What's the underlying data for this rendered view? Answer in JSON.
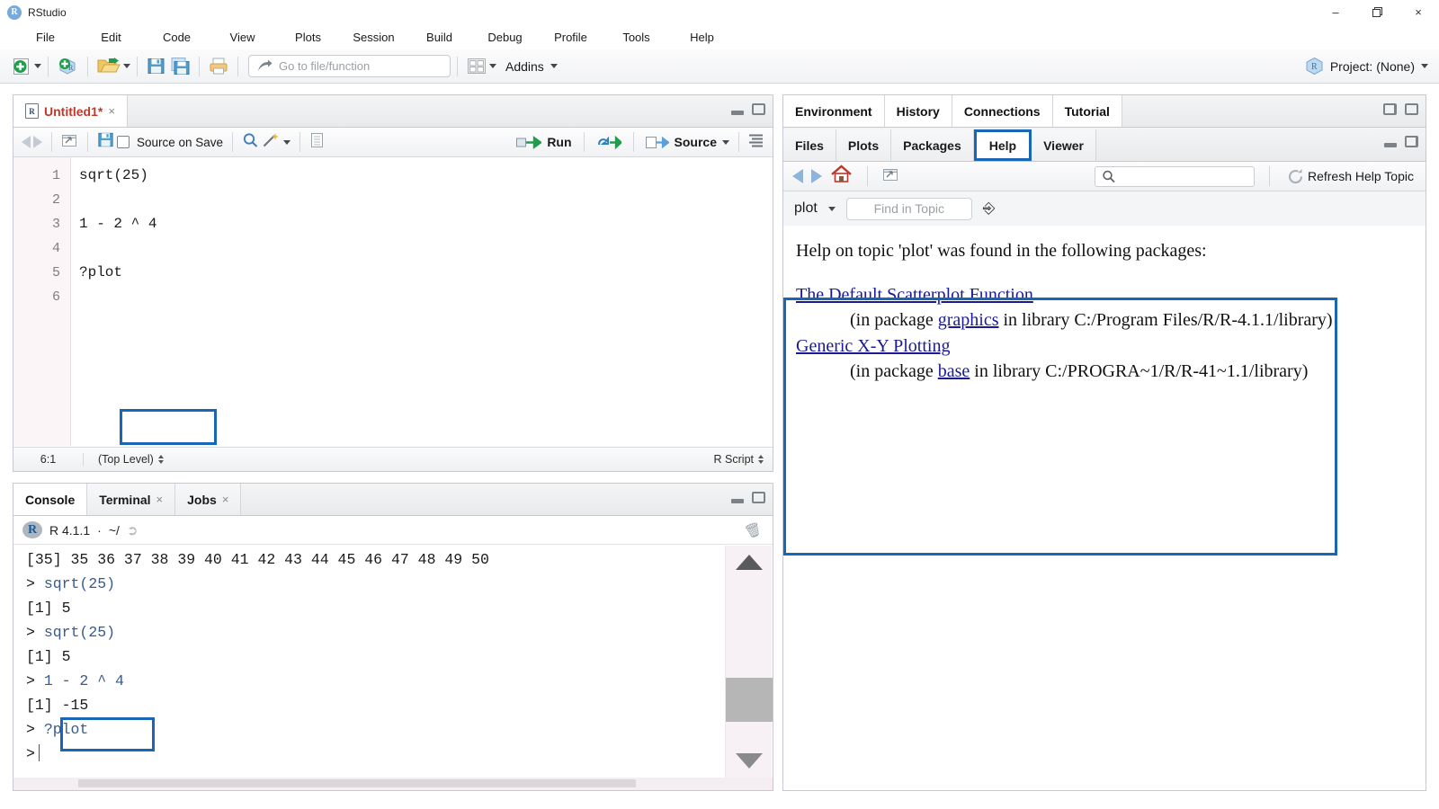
{
  "window": {
    "app_name": "RStudio",
    "app_icon": "r-logo-icon",
    "minimize": "–",
    "maximize": "❐",
    "close": "×"
  },
  "menubar": {
    "items": [
      "File",
      "Edit",
      "Code",
      "View",
      "Plots",
      "Session",
      "Build",
      "Debug",
      "Profile",
      "Tools",
      "Help"
    ]
  },
  "toolbar": {
    "new_file_icon": "new-file-plus-icon",
    "new_project_icon": "new-project-icon",
    "open_file_icon": "open-folder-icon",
    "save_icon": "save-icon",
    "save_all_icon": "save-all-icon",
    "print_icon": "print-icon",
    "goto_placeholder": "Go to file/function",
    "goto_icon": "goto-arrow-icon",
    "panes_icon": "workspace-panes-icon",
    "addins_label": "Addins",
    "project_label": "Project: (None)",
    "project_icon": "project-cube-icon"
  },
  "source": {
    "tab_title": "Untitled1*",
    "tab_close": "×",
    "tab_icon": "r-script-icon",
    "toolbar": {
      "back_icon": "back-arrow-icon",
      "forward_icon": "forward-arrow-icon",
      "popout_icon": "show-in-new-window-icon",
      "save_icon": "save-icon",
      "source_on_save_label": "Source on Save",
      "find_icon": "magnifier-icon",
      "magic_icon": "code-tools-wand-icon",
      "compile_icon": "compile-report-icon",
      "run_label": "Run",
      "run_icon": "run-arrow-icon",
      "rerun_icon": "re-run-icon",
      "source_label": "Source",
      "source_icon": "source-arrow-icon",
      "outline_icon": "document-outline-icon"
    },
    "lines": [
      {
        "n": "1",
        "text": "sqrt(25)"
      },
      {
        "n": "2",
        "text": ""
      },
      {
        "n": "3",
        "text": "1 - 2 ^ 4"
      },
      {
        "n": "4",
        "text": ""
      },
      {
        "n": "5",
        "text": "?plot"
      },
      {
        "n": "6",
        "text": ""
      }
    ],
    "highlighted_line_text": "?plot",
    "status": {
      "cursor_position": "6:1",
      "scope": "(Top Level)",
      "file_type": "R Script"
    }
  },
  "console": {
    "tabs": [
      {
        "label": "Console",
        "closable": false,
        "active": true
      },
      {
        "label": "Terminal",
        "closable": true,
        "active": false
      },
      {
        "label": "Jobs",
        "closable": true,
        "active": false
      }
    ],
    "tab_close": "×",
    "version_line": "R 4.1.1",
    "separator": "·",
    "working_dir": "~/",
    "share_icon": "share-arrow-icon",
    "clear_icon": "broom-icon",
    "lines": [
      {
        "type": "output",
        "text": "[35] 35 36 37 38 39 40 41 42 43 44 45 46 47 48 49 50"
      },
      {
        "type": "command",
        "prompt": ">",
        "text": "sqrt(25)"
      },
      {
        "type": "output",
        "text": "[1] 5"
      },
      {
        "type": "command",
        "prompt": ">",
        "text": "sqrt(25)"
      },
      {
        "type": "output",
        "text": "[1] 5"
      },
      {
        "type": "command",
        "prompt": ">",
        "text": "1 - 2 ^ 4"
      },
      {
        "type": "output",
        "text": "[1] -15"
      },
      {
        "type": "command",
        "prompt": ">",
        "text": "?plot",
        "highlighted": true
      },
      {
        "type": "command",
        "prompt": ">",
        "text": ""
      }
    ],
    "scroll_up_icon": "scroll-up-arrow-icon",
    "scroll_down_icon": "scroll-down-arrow-icon"
  },
  "right_panel": {
    "tabs_row1": [
      "Environment",
      "History",
      "Connections",
      "Tutorial"
    ],
    "tabs_row2": [
      "Files",
      "Plots",
      "Packages",
      "Help",
      "Viewer"
    ],
    "active_tab_row2": "Help",
    "help_toolbar": {
      "back_icon": "help-back-arrow-icon",
      "forward_icon": "help-forward-arrow-icon",
      "home_icon": "help-home-icon",
      "popout_icon": "show-in-new-window-icon",
      "search_icon": "magnifier-icon",
      "search_value": "",
      "refresh_label": "Refresh Help Topic",
      "refresh_icon": "refresh-circular-arrow-icon"
    },
    "find_bar": {
      "topic": "plot",
      "topic_dropdown_icon": "chevron-down-icon",
      "find_placeholder": "Find in Topic",
      "cursor_icon": "mouse-pointer-icon"
    },
    "help_content": {
      "intro": "Help on topic 'plot' was found in the following packages:",
      "entries": [
        {
          "title": "The Default Scatterplot Function",
          "detail_prefix": "(in package ",
          "package": "graphics",
          "detail_middle": " in library ",
          "library_path": "C:/Program Files/R/R-4.1.1/library)"
        },
        {
          "title": "Generic X-Y Plotting",
          "detail_prefix": "(in package ",
          "package": "base",
          "detail_middle": " in library ",
          "library_path": "C:/PROGRA~1/R/R-41~1.1/library)"
        }
      ]
    }
  },
  "colors": {
    "highlight_blue": "#1967b4",
    "link_blue": "#1a1a96",
    "source_tab_title": "#c0392b",
    "console_command": "#3a5a8c"
  }
}
